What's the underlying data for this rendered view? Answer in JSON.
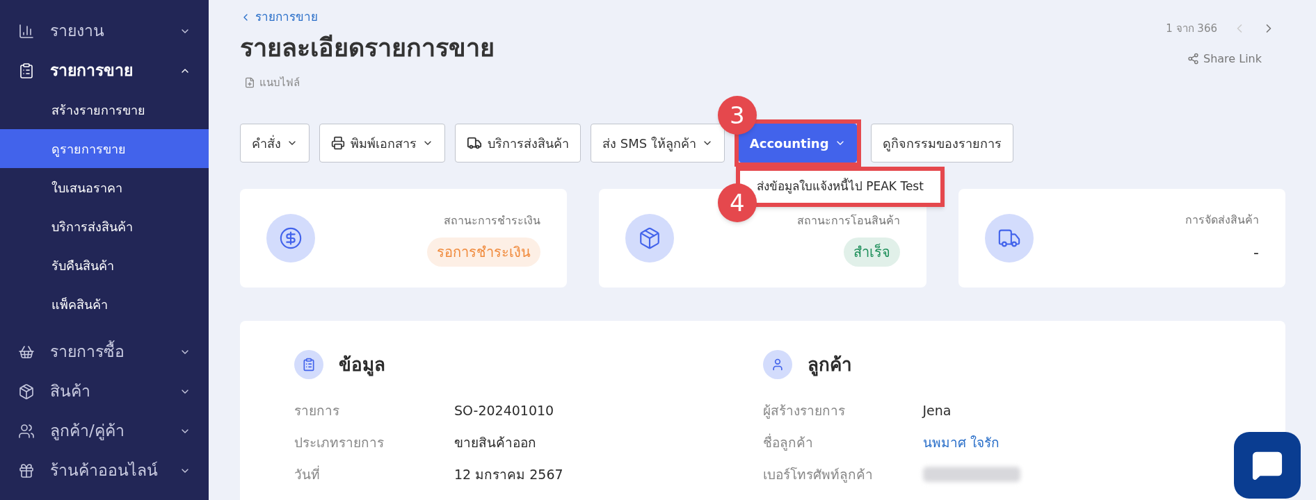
{
  "sidebar": {
    "items": [
      {
        "label": "รายงาน",
        "selected": false,
        "expanded": false
      },
      {
        "label": "รายการขาย",
        "selected": true,
        "expanded": true,
        "children": [
          {
            "label": "สร้างรายการขาย",
            "selected": false
          },
          {
            "label": "ดูรายการขาย",
            "selected": true
          },
          {
            "label": "ใบเสนอราคา",
            "selected": false
          },
          {
            "label": "บริการส่งสินค้า",
            "selected": false
          },
          {
            "label": "รับคืนสินค้า",
            "selected": false
          },
          {
            "label": "แพ็คสินค้า",
            "selected": false
          }
        ]
      },
      {
        "label": "รายการซื้อ",
        "selected": false,
        "expanded": false
      },
      {
        "label": "สินค้า",
        "selected": false,
        "expanded": false
      },
      {
        "label": "ลูกค้า/คู่ค้า",
        "selected": false,
        "expanded": false
      },
      {
        "label": "ร้านค้าออนไลน์",
        "selected": false,
        "expanded": false
      }
    ]
  },
  "header": {
    "breadcrumb": "รายการขาย",
    "title": "รายละเอียดรายการขาย",
    "attach": "แนบไฟล์",
    "pager": "1 จาก 366",
    "share": "Share Link"
  },
  "toolbar": [
    {
      "label": "คำสั่ง",
      "kind": "outline",
      "has_menu": true
    },
    {
      "label": "พิมพ์เอกสาร",
      "kind": "outline",
      "has_menu": true
    },
    {
      "label": "บริการส่งสินค้า",
      "kind": "outline",
      "has_menu": false
    },
    {
      "label": "ส่ง SMS ให้ลูกค้า",
      "kind": "outline",
      "has_menu": true
    },
    {
      "label": "Accounting",
      "kind": "primary",
      "has_menu": true,
      "annotation": "3",
      "menu": {
        "items": [
          "ส่งข้อมูลใบแจ้งหนี้ไป PEAK Test"
        ],
        "annotation": "4"
      }
    },
    {
      "label": "ดูกิจกรรมของรายการ",
      "kind": "outline",
      "has_menu": false
    }
  ],
  "status_cards": [
    {
      "label": "สถานะการชำระเงิน",
      "value": "รอการชำระเงิน",
      "kind": "badge",
      "color": "#f08a3c"
    },
    {
      "label": "สถานะการโอนสินค้า",
      "value": "สำเร็จ",
      "kind": "badge",
      "color": "#1e8f5a"
    },
    {
      "label": "การจัดส่งสินค้า",
      "value": "-",
      "kind": "plain"
    }
  ],
  "details": [
    {
      "title": "ข้อมูล",
      "rows": [
        {
          "label": "รายการ",
          "value": "SO-202401010",
          "kind": "text"
        },
        {
          "label": "ประเภทรายการ",
          "value": "ขายสินค้าออก",
          "kind": "text"
        },
        {
          "label": "วันที่",
          "value": "12 มกราคม 2567",
          "kind": "text"
        }
      ]
    },
    {
      "title": "ลูกค้า",
      "rows": [
        {
          "label": "ผู้สร้างรายการ",
          "value": "Jena",
          "kind": "text"
        },
        {
          "label": "ชื่อลูกค้า",
          "value": "นพมาศ ใจรัก",
          "kind": "link"
        },
        {
          "label": "เบอร์โทรศัพท์ลูกค้า",
          "kind": "masked"
        }
      ]
    }
  ]
}
